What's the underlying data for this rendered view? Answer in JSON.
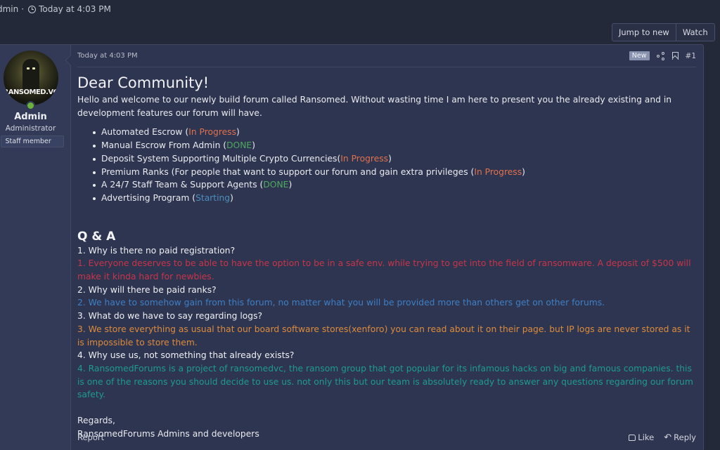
{
  "thread_meta": {
    "author": "dmin",
    "separator": "·",
    "time": "Today at 4:03 PM"
  },
  "top_buttons": {
    "jump_to_new": "Jump to new",
    "watch": "Watch"
  },
  "user": {
    "avatar_text": "RANSOMED.VC",
    "name": "Admin",
    "title": "Administrator",
    "banner": "Staff member",
    "online": true
  },
  "post": {
    "date": "Today at 4:03 PM",
    "badge": "New",
    "number": "#1",
    "greeting": "Dear Community!",
    "intro": "Hello and welcome to our newly build forum called Ransomed. Without wasting time I am here to present you the already existing and in development features our forum will have.",
    "features": [
      {
        "text": "Automated Escrow (",
        "status": "In Progress",
        "close": ")",
        "status_color": "#e0714e"
      },
      {
        "text": "Manual Escrow From Admin (",
        "status": "DONE",
        "close": ")",
        "status_color": "#4fa85f"
      },
      {
        "text": "Deposit System Supporting Multiple Crypto Currencies(",
        "status": "In Progress",
        "close": ")",
        "status_color": "#e0714e"
      },
      {
        "text": "Premium Ranks (For people that want to support our forum and gain extra privileges (",
        "status": "In Progress",
        "close": ")",
        "status_color": "#e0714e"
      },
      {
        "text": "A 24/7 Staff Team & Support Agents (",
        "status": "DONE",
        "close": ")",
        "status_color": "#4fa85f"
      },
      {
        "text": "Advertising Program (",
        "status": "Starting",
        "close": ")",
        "status_color": "#4c8ebd"
      }
    ],
    "qa_title": "Q & A",
    "qa": [
      {
        "question": "1. Why is there no paid registration?",
        "answer": "1. Everyone deserves to be able to have the option to be in a safe env. while trying to get into the field of ransomware. A deposit of $500 will make it kinda hard for newbies.",
        "answer_color": "#c7354a"
      },
      {
        "question": "2. Why will there be paid ranks?",
        "answer": "2. We have to somehow gain from this forum, no matter what you will be provided more than others get on other forums.",
        "answer_color": "#3f7fc4"
      },
      {
        "question": "3. What do we have to say regarding logs?",
        "answer": "3. We store everything as usual that our board software stores(xenforo) you can read about it on their page. but IP logs are never stored as it is impossible to store them.",
        "answer_color": "#dd8b3c"
      },
      {
        "question": "4. Why use us, not something that already exists?",
        "answer": "4. RansomedForums is a project of ransomedvc, the ransom group that got popular for its infamous hacks on big and famous companies. this is one of the reasons you should decide to use us. not only this but our team is absolutely ready to answer any questions regarding our forum safety.",
        "answer_color": "#1f9a8f"
      }
    ],
    "regards": "Regards,",
    "signature": "RansomedForums Admins and developers"
  },
  "footer": {
    "report": "Report",
    "like": "Like",
    "reply": "Reply"
  },
  "icons": {
    "clock": "clock-icon",
    "share": "share-icon",
    "bookmark": "bookmark-icon",
    "like": "thumbs-up-icon",
    "reply": "reply-arrow-icon",
    "online": "online-user-icon"
  }
}
